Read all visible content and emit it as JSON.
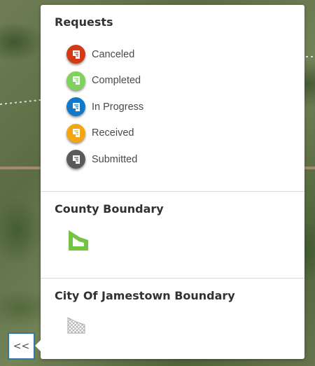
{
  "legend": {
    "requests": {
      "title": "Requests",
      "items": [
        {
          "label": "Canceled",
          "color": "#d33a14",
          "icon": "canceled-request-icon"
        },
        {
          "label": "Completed",
          "color": "#7fd25a",
          "icon": "completed-request-icon"
        },
        {
          "label": "In Progress",
          "color": "#1278c8",
          "icon": "in-progress-request-icon"
        },
        {
          "label": "Received",
          "color": "#f4a512",
          "icon": "received-request-icon"
        },
        {
          "label": "Submitted",
          "color": "#5a5a5a",
          "icon": "submitted-request-icon"
        }
      ]
    },
    "county": {
      "title": "County Boundary",
      "color": "#72c442",
      "icon": "county-boundary-symbol"
    },
    "city": {
      "title": "City Of Jamestown Boundary",
      "icon": "city-boundary-symbol"
    }
  },
  "collapse_button": {
    "label": "<<",
    "icon": "collapse-chevrons-icon"
  }
}
